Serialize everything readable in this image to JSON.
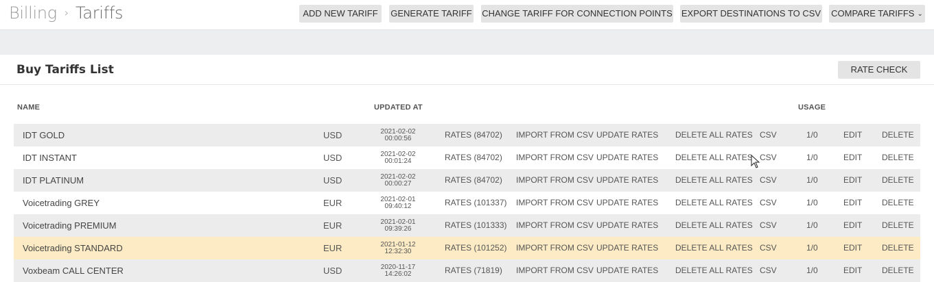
{
  "breadcrumb": {
    "parent": "Billing",
    "separator": "›",
    "current": "Tariffs"
  },
  "toolbar": {
    "add_new_tariff": "ADD NEW TARIFF",
    "generate_tariff": "GENERATE TARIFF",
    "change_tariff": "CHANGE TARIFF FOR CONNECTION POINTS",
    "export_destinations": "EXPORT DESTINATIONS TO CSV",
    "compare_tariffs": "COMPARE TARIFFS"
  },
  "panel": {
    "title": "Buy Tariffs List",
    "rate_check": "RATE CHECK"
  },
  "table": {
    "headers": {
      "name": "NAME",
      "updated_at": "UPDATED AT",
      "usage": "USAGE"
    },
    "rows": [
      {
        "name": "IDT GOLD",
        "currency": "USD",
        "date": "2021-02-02",
        "time": "00:00:56",
        "rates": "RATES (84702)",
        "import": "IMPORT FROM CSV",
        "update": "UPDATE RATES",
        "delete_all": "DELETE ALL RATES",
        "csv": "CSV",
        "usage": "1/0",
        "edit": "EDIT",
        "delete": "DELETE"
      },
      {
        "name": "IDT INSTANT",
        "currency": "USD",
        "date": "2021-02-02",
        "time": "00:01:24",
        "rates": "RATES (84702)",
        "import": "IMPORT FROM CSV",
        "update": "UPDATE RATES",
        "delete_all": "DELETE ALL RATES",
        "csv": "CSV",
        "usage": "1/0",
        "edit": "EDIT",
        "delete": "DELETE"
      },
      {
        "name": "IDT PLATINUM",
        "currency": "USD",
        "date": "2021-02-02",
        "time": "00:00:27",
        "rates": "RATES (84702)",
        "import": "IMPORT FROM CSV",
        "update": "UPDATE RATES",
        "delete_all": "DELETE ALL RATES",
        "csv": "CSV",
        "usage": "1/0",
        "edit": "EDIT",
        "delete": "DELETE"
      },
      {
        "name": "Voicetrading GREY",
        "currency": "EUR",
        "date": "2021-02-01",
        "time": "09:40:12",
        "rates": "RATES (101337)",
        "import": "IMPORT FROM CSV",
        "update": "UPDATE RATES",
        "delete_all": "DELETE ALL RATES",
        "csv": "CSV",
        "usage": "1/0",
        "edit": "EDIT",
        "delete": "DELETE"
      },
      {
        "name": "Voicetrading PREMIUM",
        "currency": "EUR",
        "date": "2021-02-01",
        "time": "09:39:26",
        "rates": "RATES (101333)",
        "import": "IMPORT FROM CSV",
        "update": "UPDATE RATES",
        "delete_all": "DELETE ALL RATES",
        "csv": "CSV",
        "usage": "1/0",
        "edit": "EDIT",
        "delete": "DELETE"
      },
      {
        "name": "Voicetrading STANDARD",
        "currency": "EUR",
        "date": "2021-01-12",
        "time": "12:32:30",
        "rates": "RATES (101252)",
        "import": "IMPORT FROM CSV",
        "update": "UPDATE RATES",
        "delete_all": "DELETE ALL RATES",
        "csv": "CSV",
        "usage": "1/0",
        "edit": "EDIT",
        "delete": "DELETE"
      },
      {
        "name": "Voxbeam CALL CENTER",
        "currency": "USD",
        "date": "2020-11-17",
        "time": "14:26:02",
        "rates": "RATES (71819)",
        "import": "IMPORT FROM CSV",
        "update": "UPDATE RATES",
        "delete_all": "DELETE ALL RATES",
        "csv": "CSV",
        "usage": "1/0",
        "edit": "EDIT",
        "delete": "DELETE"
      }
    ],
    "highlighted_row": 5
  },
  "icons": {
    "chevron": "chevron-down-icon",
    "cursor": "mouse-pointer-icon"
  },
  "colors": {
    "highlight": "#fcebc4",
    "button_bg": "#e4e4e4",
    "band": "#eceef0"
  }
}
